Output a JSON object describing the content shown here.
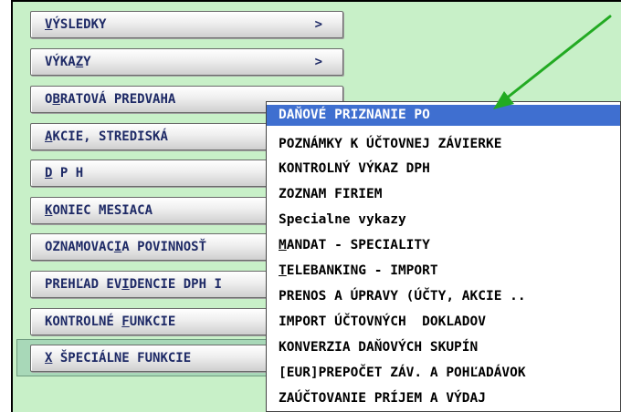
{
  "menu": {
    "items": [
      {
        "pre": "",
        "ul": "V",
        "post": "ÝSLEDKY",
        "arrow": ">"
      },
      {
        "pre": "VÝKA",
        "ul": "Z",
        "post": "Y",
        "arrow": ">"
      },
      {
        "pre": "O",
        "ul": "B",
        "post": "RATOVÁ PREDVAHA",
        "arrow": ""
      },
      {
        "pre": "",
        "ul": "A",
        "post": "KCIE, STREDISKÁ",
        "arrow": ""
      },
      {
        "pre": "",
        "ul": "D",
        "post": " P H",
        "arrow": ""
      },
      {
        "pre": "",
        "ul": "K",
        "post": "ONIEC MESIACA",
        "arrow": ""
      },
      {
        "pre": "OZNAMOVAC",
        "ul": "I",
        "post": "A POVINNOSŤ",
        "arrow": ""
      },
      {
        "pre": "PREHĽAD EV",
        "ul": "I",
        "post": "DENCIE DPH I",
        "arrow": ""
      },
      {
        "pre": "KONTROLNÉ ",
        "ul": "F",
        "post": "UNKCIE",
        "arrow": ""
      },
      {
        "pre": "",
        "ul": "X",
        "post": " ŠPECIÁLNE FUNKCIE",
        "arrow": ""
      }
    ]
  },
  "submenu": {
    "items": [
      {
        "pre": "DAŇOVÉ PRIZNANIE PO",
        "ul": "",
        "post": ""
      },
      {
        "pre": "POZNÁMKY K ÚČTOVNEJ ZÁVIERKE",
        "ul": "",
        "post": ""
      },
      {
        "pre": "KONTROLNÝ VÝKAZ DPH",
        "ul": "",
        "post": ""
      },
      {
        "pre": "ZOZNAM FIRIEM",
        "ul": "",
        "post": ""
      },
      {
        "pre": "Specialne vykazy",
        "ul": "",
        "post": ""
      },
      {
        "pre": "",
        "ul": "M",
        "post": "ANDAT - SPECIALITY"
      },
      {
        "pre": "",
        "ul": "T",
        "post": "ELEBANKING - IMPORT"
      },
      {
        "pre": "PRENOS A ÚPRAVY (ÚČTY, AKCIE ..",
        "ul": "",
        "post": ""
      },
      {
        "pre": "IMPORT ÚČTOVNÝCH  DOKLADOV",
        "ul": "",
        "post": ""
      },
      {
        "pre": "KONVERZIA DAŇOVÝCH SKUPÍN",
        "ul": "",
        "post": ""
      },
      {
        "pre": "[EUR]PREPOČET ZÁV. A POHĽADÁVOK",
        "ul": "",
        "post": ""
      },
      {
        "pre": "ZAÚČTOVANIE PRÍJEM A VÝDAJ",
        "ul": "",
        "post": ""
      }
    ]
  },
  "colors": {
    "panel_bg": "#c8f0c8",
    "highlight": "#3f6fd0",
    "arrow": "#22aa22"
  }
}
